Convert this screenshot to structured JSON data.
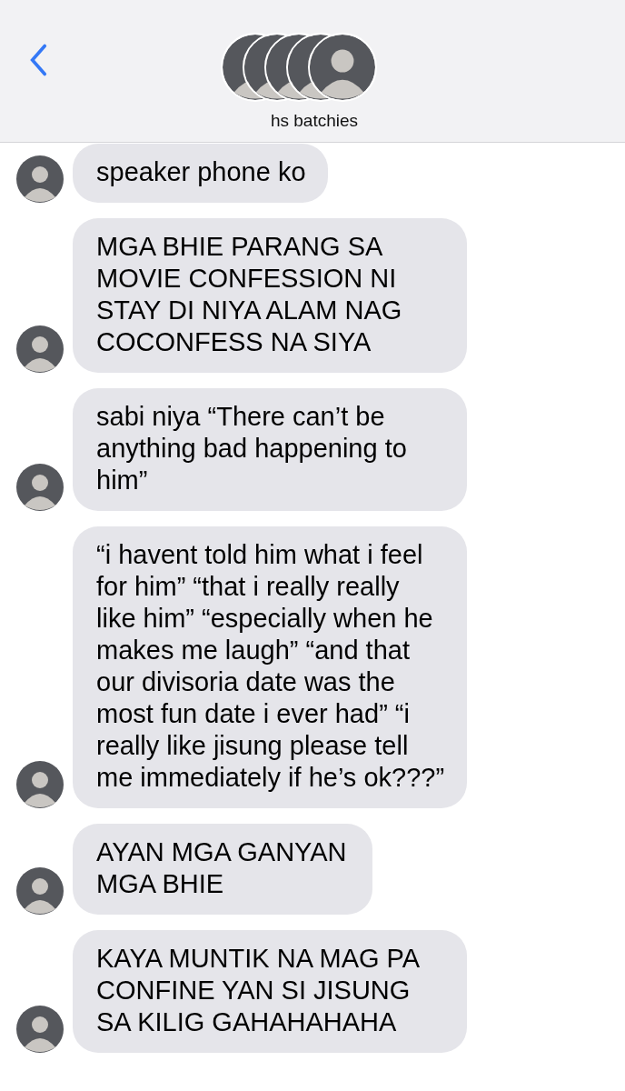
{
  "header": {
    "title": "hs batchies"
  },
  "messages": [
    {
      "text": "speaker phone ko"
    },
    {
      "text": "MGA BHIE PARANG SA MOVIE CONFESSION NI STAY DI NIYA ALAM NAG COCONFESS NA SIYA"
    },
    {
      "text": "sabi niya “There can’t be anything bad happening to him”"
    },
    {
      "text": "“i havent told him what i feel for him” “that i really really like him” “especially when he makes me laugh” “and that our divisoria date was the most fun date i ever had” “i really like jisung please tell me immediately if he’s ok???”"
    },
    {
      "text": "AYAN MGA GANYAN MGA BHIE"
    },
    {
      "text": "KAYA MUNTIK NA MAG PA CONFINE YAN SI JISUNG SA KILIG GAHAHAHAHA"
    }
  ]
}
